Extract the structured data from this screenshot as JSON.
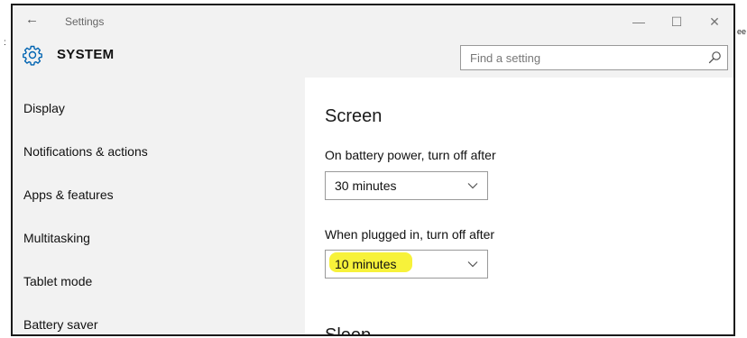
{
  "window": {
    "title": "Settings",
    "controls": {
      "minimize": "—",
      "maximize": "☐",
      "close": "✕"
    }
  },
  "header": {
    "section_title": "SYSTEM",
    "search": {
      "placeholder": "Find a setting",
      "value": ""
    }
  },
  "sidebar": {
    "items": [
      {
        "label": "Display"
      },
      {
        "label": "Notifications & actions"
      },
      {
        "label": "Apps & features"
      },
      {
        "label": "Multitasking"
      },
      {
        "label": "Tablet mode"
      },
      {
        "label": "Battery saver"
      }
    ]
  },
  "main": {
    "title": "Screen",
    "battery_label": "On battery power, turn off after",
    "battery_value": "30 minutes",
    "plugged_label": "When plugged in, turn off after",
    "plugged_value": "10 minutes",
    "next_section_title": "Sleep"
  },
  "colors": {
    "highlight": "#f7f23a",
    "accent": "#0063b1"
  }
}
